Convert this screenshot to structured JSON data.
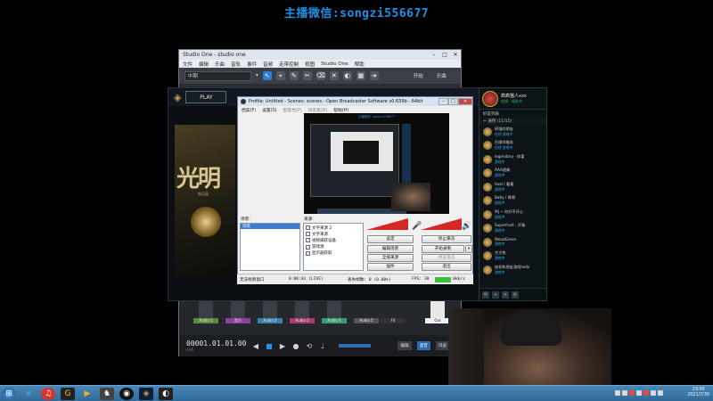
{
  "watermark": "主播微信:songzi556677",
  "studio_one": {
    "title": "Studio One - studio one",
    "menu": [
      "文件",
      "编辑",
      "乐曲",
      "音轨",
      "事件",
      "音频",
      "走带控制",
      "视图",
      "Studio One",
      "帮助"
    ],
    "combo_value": "中期",
    "toolbar_right": [
      "开始",
      "乐曲"
    ],
    "track_labels": [
      "Audio 1",
      "音乐",
      "Audio 2",
      "Audio 3",
      "Audio 4",
      "Audio 5",
      "FX",
      "Out"
    ],
    "timecode": "00001.01.01.00",
    "timecode_unit": "小节",
    "right_buttons": [
      "编辑",
      "混音",
      "浏览"
    ]
  },
  "lol": {
    "play_label": "PLAY",
    "art_title": "光明",
    "art_sub": "钻石局"
  },
  "friends": {
    "user_name": "疯疯猫人xxx",
    "user_status": "在线 - 组队中",
    "tab_label": "好友列表",
    "group_label": "+ 通用 (11/15)",
    "items": [
      {
        "name": "阿强的朋友",
        "status": "在线 游戏中"
      },
      {
        "name": "召唤师服务",
        "status": "在线 游戏中"
      },
      {
        "name": "legendary · 惊喜",
        "status": "游戏中"
      },
      {
        "name": "AAA超威",
        "status": "游戏中"
      },
      {
        "name": "Axel / 看看",
        "status": "游戏中"
      },
      {
        "name": "Baby / 哥哥",
        "status": "游戏中"
      },
      {
        "name": "MJ ~ 你好不开心",
        "status": "游戏中"
      },
      {
        "name": "Superfrost · 开服",
        "status": "游戏中"
      },
      {
        "name": "WoodGreen",
        "status": "游戏中"
      },
      {
        "name": "大大兔",
        "status": "游戏中"
      },
      {
        "name": "结伴和朋友游戏hello",
        "status": "游戏中"
      }
    ]
  },
  "obs": {
    "title": "Profile: Untitled - Scenes: scenes - Open Broadcaster Software v0.659b - 64bit",
    "menu": [
      "档案(F)",
      "设置(S)",
      "配置档(P)",
      "场景集(N)",
      "帮助(H)"
    ],
    "menu_dim": [
      false,
      false,
      true,
      true,
      false
    ],
    "preview_caption": "主播微信 songzi556677",
    "scenes_label": "场景:",
    "scene_selected": "场景",
    "sources_label": "来源:",
    "sources": [
      "文字来源 2",
      "文字来源",
      "视频捕获设备",
      "游戏源",
      "显示器获取"
    ],
    "buttons": {
      "settings": "设定",
      "stop_live": "停止串流",
      "edit_scene": "编辑场景",
      "start_record": "开始录制",
      "fullscreen": "全域来源",
      "tally": "预览串流",
      "plugins": "插件",
      "exit": "退出"
    },
    "status": {
      "window": "无法找到窗口",
      "time": "0:00:01 (LIVE)",
      "dropped": "丢失帧数: 0 (0.00%)",
      "fps": "FPS: 30",
      "bitrate": "0kb/s"
    }
  },
  "taskbar": {
    "time": "23:00",
    "date": "2021/7/30"
  }
}
